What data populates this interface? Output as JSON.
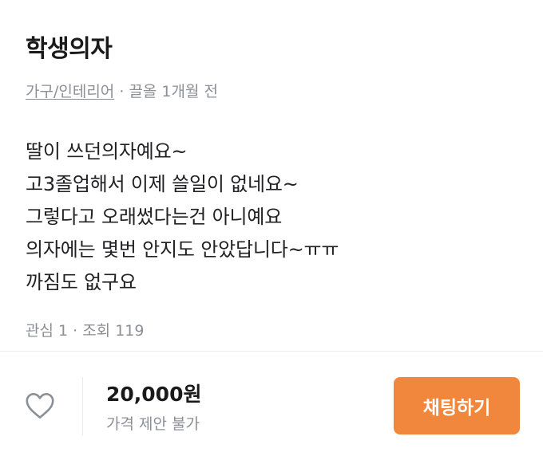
{
  "product": {
    "title": "학생의자",
    "category": "가구/인테리어",
    "separator": "·",
    "time": "끌올 1개월 전"
  },
  "description": {
    "lines": [
      "딸이 쓰던의자예요~",
      "고3졸업해서 이제 쓸일이 없네요~",
      "그렇다고 오래썼다는건 아니예요",
      "의자에는 몇번 안지도 안았답니다~ㅠㅠ",
      "까짐도 없구요"
    ]
  },
  "stats": {
    "text": "관심 1 · 조회 119"
  },
  "bottom_bar": {
    "like_icon": "heart-outline-icon",
    "price": "20,000원",
    "price_note": "가격 제안 불가",
    "chat_label": "채팅하기"
  },
  "colors": {
    "accent": "#f0873c",
    "muted_text": "#8b8f96",
    "body_text": "#212124",
    "divider": "#e9ecef"
  }
}
